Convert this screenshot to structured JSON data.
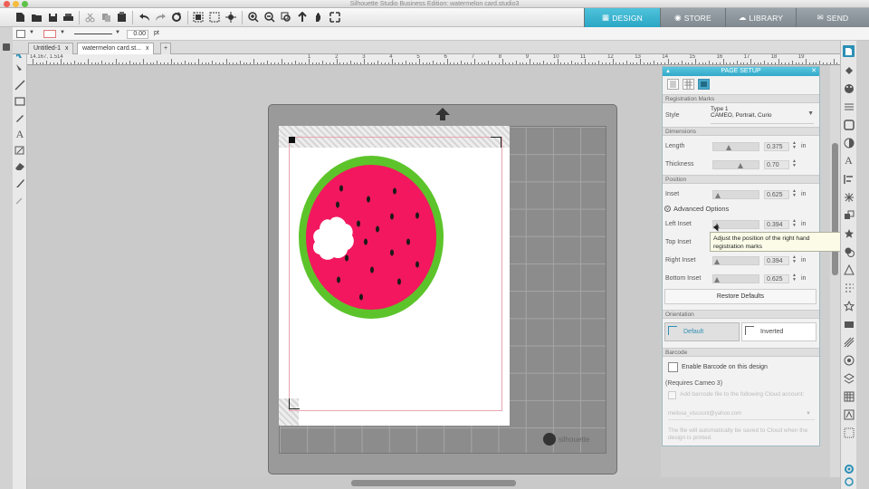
{
  "window": {
    "title": "Silhouette Studio Business Edition: watermelon card.studio3"
  },
  "nav": {
    "design": "DESIGN",
    "store": "STORE",
    "library": "LIBRARY",
    "send": "SEND"
  },
  "options": {
    "line_value": "0.00",
    "line_unit": "pt"
  },
  "tabs": [
    {
      "label": "Untitled-1",
      "close": "x",
      "active": false
    },
    {
      "label": "watermelon card.st...",
      "close": "x",
      "active": true
    }
  ],
  "tabs_add": "+",
  "ruler": {
    "readout": "14.167, 1.514",
    "numbers": [
      "1",
      "2",
      "3",
      "4",
      "5",
      "6",
      "7",
      "8",
      "9",
      "10",
      "11",
      "12",
      "13",
      "14",
      "15",
      "16",
      "17",
      "18",
      "19"
    ]
  },
  "panel": {
    "title": "PAGE SETUP",
    "registration_marks": "Registration Marks",
    "style_label": "Style",
    "style_value_1": "Type 1",
    "style_value_2": "CAMEO, Portrait, Curio",
    "dimensions": "Dimensions",
    "length_label": "Length",
    "length_value": "0.375",
    "thickness_label": "Thickness",
    "thickness_value": "0.70",
    "position": "Position",
    "inset_label": "Inset",
    "inset_value": "0.625",
    "advanced": "Advanced Options",
    "left_inset_label": "Left Inset",
    "left_inset_value": "0.394",
    "top_inset_label": "Top Inset",
    "right_inset_label": "Right Inset",
    "right_inset_value": "0.394",
    "bottom_inset_label": "Bottom Inset",
    "bottom_inset_value": "0.625",
    "unit": "in",
    "restore": "Restore Defaults",
    "orientation": "Orientation",
    "default_label": "Default",
    "inverted_label": "Inverted",
    "barcode": "Barcode",
    "enable_barcode": "Enable Barcode on this design",
    "requires": "(Requires Cameo 3)",
    "add_barcode": "Add barcode file to the following Cloud account:",
    "account": "melissa_viscount@yahoo.com",
    "cloud_note": "The file will automatically be saved to Cloud when the design is printed."
  },
  "tooltip": {
    "line1": "Adjust the position of the right hand",
    "line2": "registration marks"
  },
  "mat_brand": "silhouette",
  "colors": {
    "accent": "#33a9c8",
    "watermelon_rind": "#55c52a",
    "watermelon_flesh": "#f2175f",
    "seed": "#1a1a1a"
  }
}
